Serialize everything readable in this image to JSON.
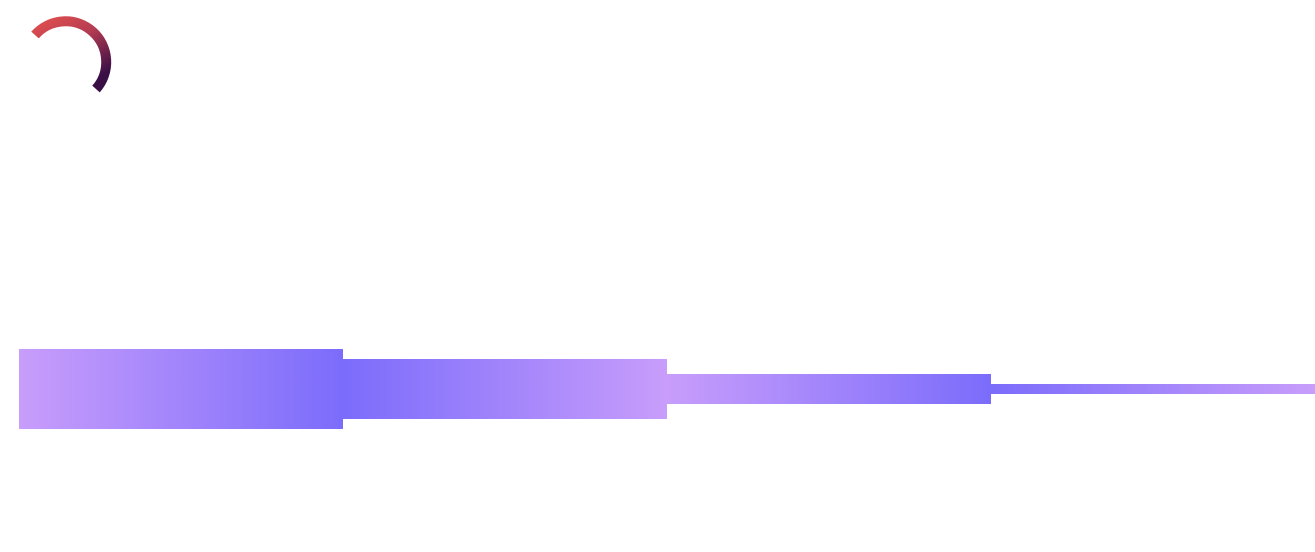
{
  "colors": {
    "spinner_start": "#e0504e",
    "spinner_end": "#3a0f45",
    "bar_light": "#c89dfb",
    "bar_dark": "#7b6cfb",
    "background": "#ffffff"
  },
  "icons": {
    "spinner": "loading-spinner-icon"
  }
}
